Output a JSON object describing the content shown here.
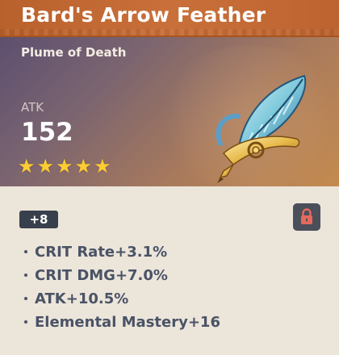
{
  "artifact": {
    "name": "Bard's Arrow Feather",
    "slot": "Plume of Death",
    "main_stat_label": "ATK",
    "main_stat_value": "152",
    "rarity_stars": 5,
    "level": "+8",
    "locked": true,
    "substats": [
      {
        "label": "CRIT Rate+3.1%"
      },
      {
        "label": "CRIT DMG+7.0%"
      },
      {
        "label": "ATK+10.5%"
      },
      {
        "label": "Elemental Mastery+16"
      }
    ]
  },
  "colors": {
    "title_bar": "#c16733",
    "star": "#ffcc32",
    "lock_icon": "#e46a5c",
    "badge_bg": "#39404d",
    "substat_text": "#4a5366"
  },
  "icons": {
    "star": "star-icon",
    "lock": "lock-icon",
    "artifact": "feather-artifact-icon"
  }
}
